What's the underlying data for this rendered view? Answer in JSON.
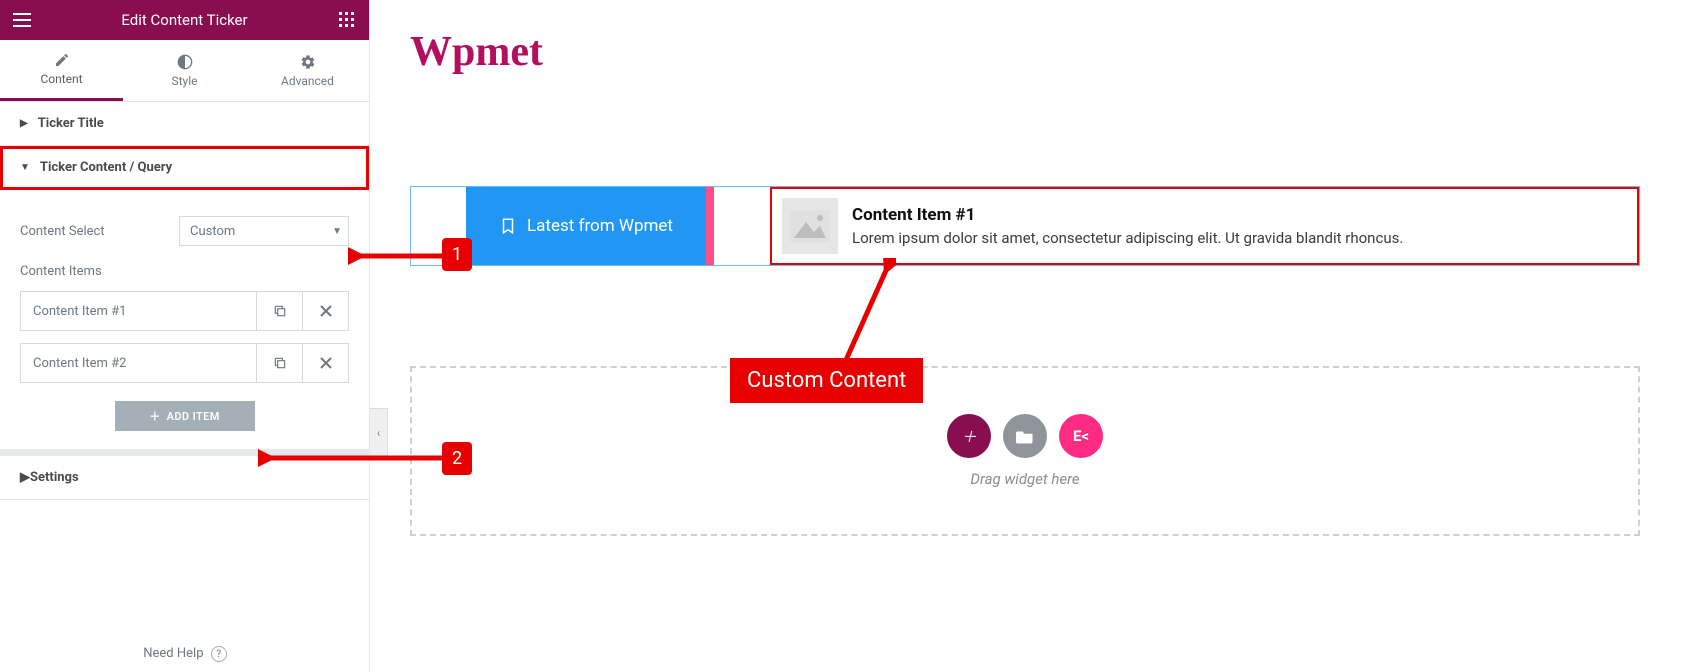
{
  "header": {
    "title": "Edit Content Ticker"
  },
  "tabs": {
    "content": "Content",
    "style": "Style",
    "advanced": "Advanced"
  },
  "sections": {
    "ticker_title": "Ticker Title",
    "ticker_content": "Ticker Content / Query",
    "settings": "Settings"
  },
  "controls": {
    "content_select_label": "Content Select",
    "content_select_value": "Custom",
    "content_items_label": "Content Items",
    "items": [
      {
        "label": "Content Item #1"
      },
      {
        "label": "Content Item #2"
      }
    ],
    "add_item": "ADD ITEM"
  },
  "footer": {
    "need_help": "Need Help"
  },
  "canvas": {
    "brand": "Wpmet",
    "ticker_badge": "Latest from Wpmet",
    "content_title": "Content Item #1",
    "content_desc": "Lorem ipsum dolor sit amet, consectetur adipiscing elit. Ut gravida blandit rhoncus.",
    "drop_hint": "Drag widget here"
  },
  "annotations": {
    "n1": "1",
    "n2": "2",
    "callout": "Custom Content"
  }
}
